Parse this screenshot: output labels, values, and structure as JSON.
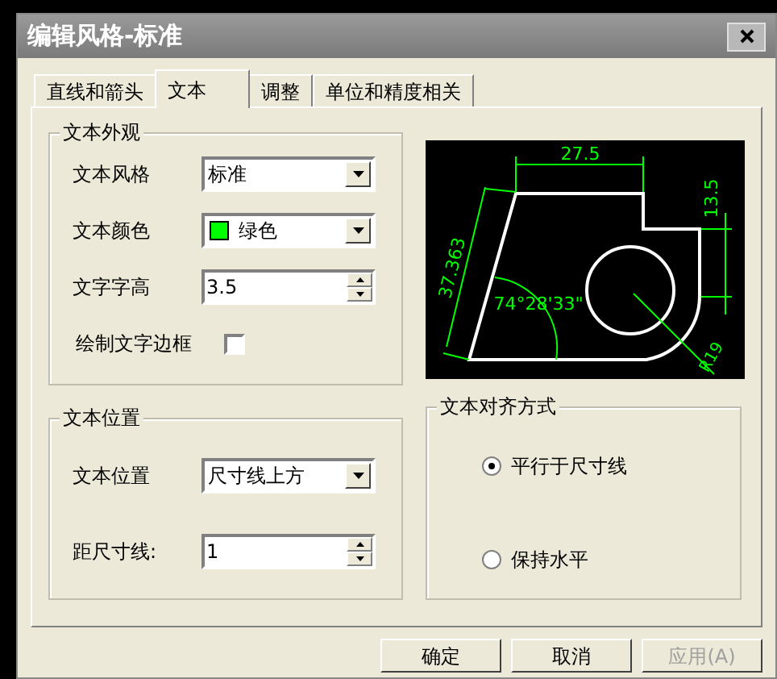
{
  "window": {
    "title": "编辑风格-标准"
  },
  "tabs": [
    {
      "label": "直线和箭头",
      "selected": false
    },
    {
      "label": "文本",
      "selected": true
    },
    {
      "label": "调整",
      "selected": false
    },
    {
      "label": "单位和精度相关",
      "selected": false
    }
  ],
  "appearance": {
    "title": "文本外观",
    "fields": [
      {
        "kind": "select",
        "label": "文本风格",
        "value": "标准"
      },
      {
        "kind": "color-select",
        "label": "文本颜色",
        "value": "绿色",
        "color": "#00ff00"
      },
      {
        "kind": "spinner",
        "label": "文字字高",
        "value": "3.5"
      },
      {
        "kind": "checkbox",
        "label": "绘制文字边框",
        "checked": false
      }
    ]
  },
  "preview": {
    "labels": [
      "27.5",
      "13.5",
      "37.363",
      "74°28'33\"",
      "R19"
    ]
  },
  "position": {
    "title": "文本位置",
    "fields": [
      {
        "kind": "select",
        "label": "文本位置",
        "value": "尺寸线上方"
      },
      {
        "kind": "spinner",
        "label": "距尺寸线:",
        "value": "1"
      }
    ]
  },
  "alignment": {
    "title": "文本对齐方式",
    "options": [
      {
        "label": "平行于尺寸线",
        "selected": true
      },
      {
        "label": "保持水平",
        "selected": false
      }
    ]
  },
  "buttons": [
    {
      "label": "确定",
      "disabled": false
    },
    {
      "label": "取消",
      "disabled": false
    },
    {
      "label": "应用(A)",
      "disabled": true
    }
  ]
}
